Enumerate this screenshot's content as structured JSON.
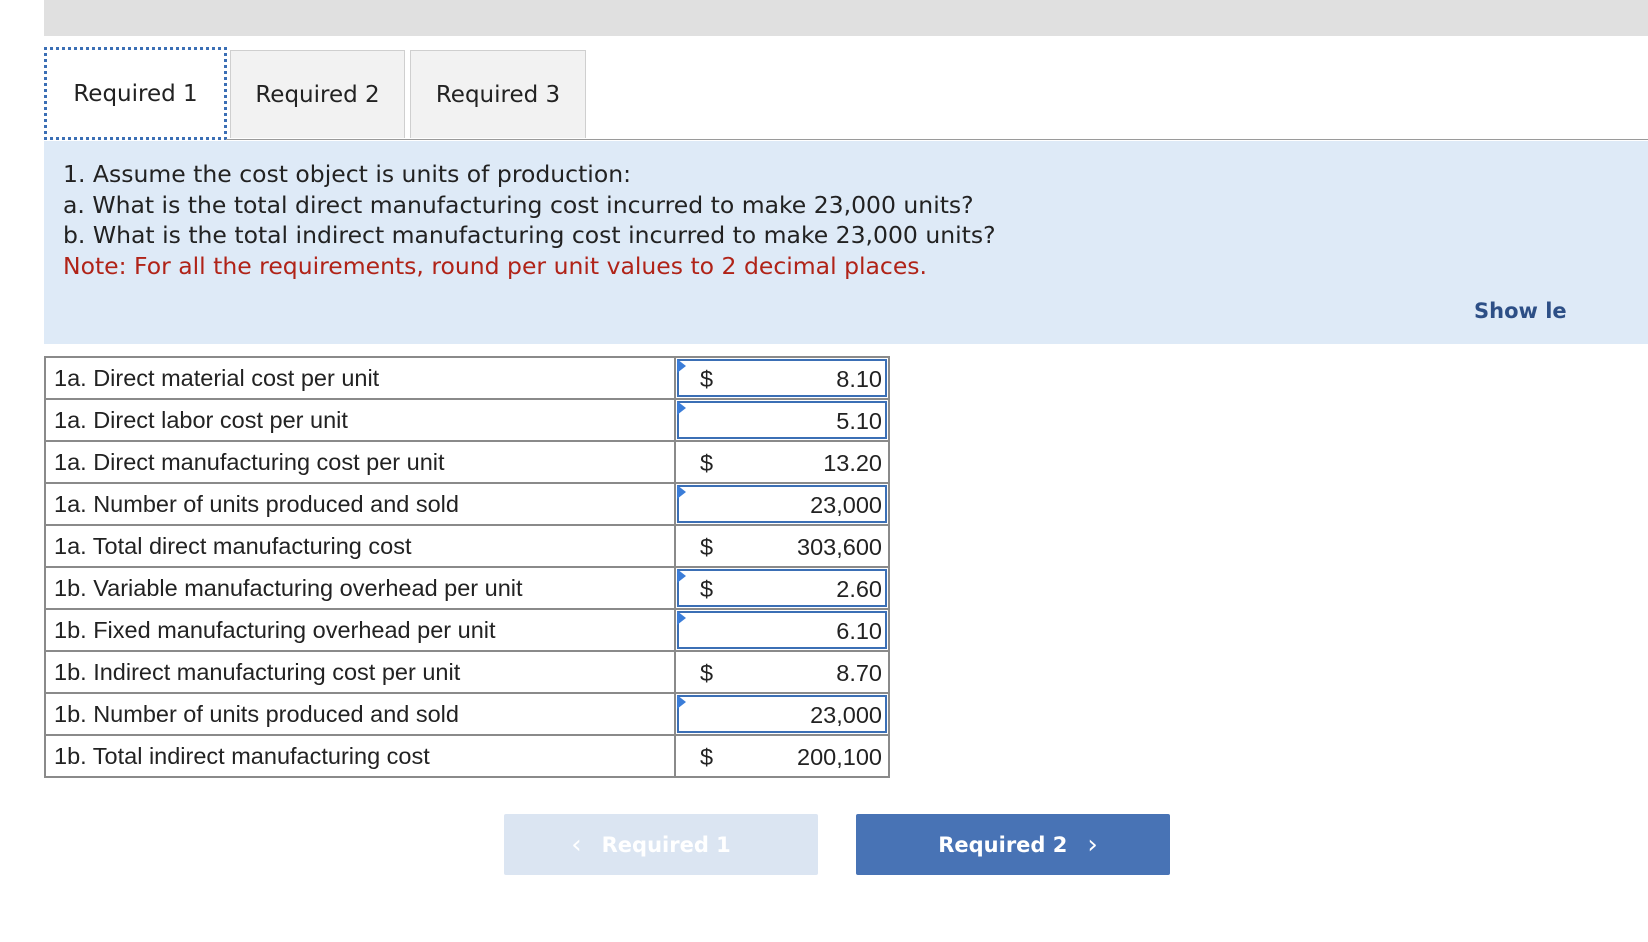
{
  "tabs": [
    {
      "label": "Required 1",
      "active": true
    },
    {
      "label": "Required 2",
      "active": false
    },
    {
      "label": "Required 3",
      "active": false
    }
  ],
  "question": {
    "line1": "1. Assume the cost object is units of production:",
    "line2": "a. What is the total direct manufacturing cost incurred to make 23,000 units?",
    "line3": "b. What is the total indirect manufacturing cost incurred to make 23,000 units?",
    "note": "Note: For all the requirements, round per unit values to 2 decimal places."
  },
  "show_less_label": "Show le",
  "rows": [
    {
      "label": "1a. Direct material cost per unit",
      "dollar": "$",
      "value": "8.10",
      "input": true
    },
    {
      "label": "1a. Direct labor cost per unit",
      "dollar": "",
      "value": "5.10",
      "input": true
    },
    {
      "label": "1a. Direct manufacturing cost per unit",
      "dollar": "$",
      "value": "13.20",
      "input": false
    },
    {
      "label": "1a. Number of units produced and sold",
      "dollar": "",
      "value": "23,000",
      "input": true
    },
    {
      "label": "1a. Total direct manufacturing cost",
      "dollar": "$",
      "value": "303,600",
      "input": false
    },
    {
      "label": "1b. Variable manufacturing overhead per unit",
      "dollar": "$",
      "value": "2.60",
      "input": true
    },
    {
      "label": "1b. Fixed manufacturing overhead per unit",
      "dollar": "",
      "value": "6.10",
      "input": true
    },
    {
      "label": "1b. Indirect manufacturing cost per unit",
      "dollar": "$",
      "value": "8.70",
      "input": false
    },
    {
      "label": "1b. Number of units produced and sold",
      "dollar": "",
      "value": "23,000",
      "input": true
    },
    {
      "label": "1b. Total indirect manufacturing cost",
      "dollar": "$",
      "value": "200,100",
      "input": false
    }
  ],
  "nav": {
    "prev_label": "Required 1",
    "next_label": "Required 2",
    "prev_icon": "chevron-left-icon",
    "next_icon": "chevron-right-icon"
  },
  "colors": {
    "accent": "#4873b5",
    "note": "#b02318",
    "question_bg": "#deeaf7"
  }
}
